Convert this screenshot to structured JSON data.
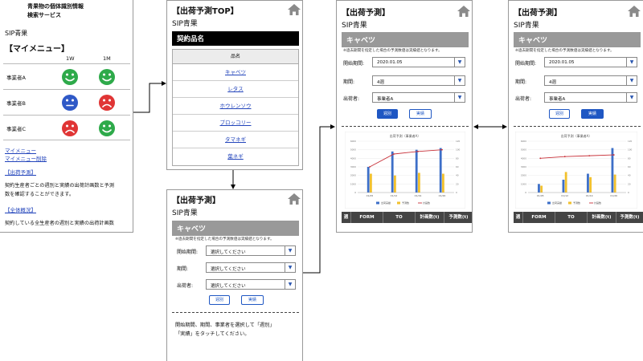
{
  "p1": {
    "service_line1": "青果物の個体識別情報",
    "service_line2": "検索サービス",
    "sip": "SIP青果",
    "menu_title": "【マイメニュー】",
    "col_1w": "1W",
    "col_1m": "1M",
    "rows": [
      {
        "label": "事業者A",
        "w": "happy",
        "m": "happy"
      },
      {
        "label": "事業者B",
        "w": "neutral",
        "m": "sad"
      },
      {
        "label": "事業者C",
        "w": "sad",
        "m": "happy"
      }
    ],
    "link_mymenu": "マイメニュー",
    "link_mymenu_delete": "マイメニュー削除",
    "sec1_title": "【出荷予測】",
    "sec1_text_1": "契約生産者ごとの週別と実績の出荷計画数と予測",
    "sec1_text_2": "数を確認することができます。",
    "sec2_title": "【全体概況】",
    "sec2_text": "契約している全生産者の週別と実績の出荷計画数"
  },
  "p2": {
    "title": "【出荷予測TOP】",
    "sip": "SIP青果",
    "bar": "契約品名",
    "table_header": "品名",
    "items": [
      "キャベツ",
      "レタス",
      "ホウレンソウ",
      "ブロッコリー",
      "タマネギ",
      "葉ネギ"
    ]
  },
  "p3": {
    "title": "【出荷予測】",
    "sip": "SIP青果",
    "bar": "キャベツ",
    "note": "※過去期間を指定した場合の予測数値は実績値となります。",
    "start_label": "開始期間:",
    "period_label": "期間:",
    "shipper_label": "出荷者:",
    "start_value": "選択してください",
    "period_value": "選択してください",
    "shipper_value": "選択してください",
    "btn_week": "週別",
    "btn_actual": "実績",
    "help_1": "開始期間、期間、事業者を選択して「週別」",
    "help_2": "「実績」をタッチしてください。"
  },
  "p4": {
    "title": "【出荷予測】",
    "sip": "SIP青果",
    "bar": "キャベツ",
    "note": "※過去期間を指定した場合の予測数値は実績値となります。",
    "start_label": "開始期間:",
    "period_label": "期間:",
    "shipper_label": "出荷者:",
    "start_value": "2020.01.05",
    "period_value": "4週",
    "shipper_value": "事業者A",
    "btn_week": "週別",
    "btn_actual": "実績",
    "table_cols": [
      "週",
      "FORM",
      "TO",
      "計画数(t)",
      "予測数(t)"
    ]
  },
  "p5": {
    "title": "【出荷予測】",
    "sip": "SIP青果",
    "bar": "キャベツ",
    "note": "※過去期間を指定した場合の予測数値は実績値となります。",
    "start_label": "開始期間:",
    "period_label": "期間:",
    "shipper_label": "出荷者:",
    "start_value": "2020.01.05",
    "period_value": "4週",
    "shipper_value": "事業者A",
    "btn_week": "週別",
    "btn_actual": "実績",
    "table_cols": [
      "週",
      "FORM",
      "TO",
      "計画数(t)",
      "予測数(t)"
    ]
  },
  "chart_data": [
    {
      "type": "bar",
      "title": "出荷予測（事業者A）",
      "categories": [
        "01/05",
        "01/12",
        "01/19",
        "01/26"
      ],
      "series": [
        {
          "name": "出荷実績",
          "values": [
            3000,
            4800,
            5000,
            5200
          ]
        },
        {
          "name": "予測数",
          "values": [
            2200,
            2000,
            2300,
            2200
          ]
        },
        {
          "name": "計画数",
          "values": [
            3000,
            4500,
            4800,
            5000
          ],
          "kind": "line"
        }
      ],
      "ylim": [
        0,
        6000
      ],
      "y2lim": [
        0,
        120
      ],
      "legend": "bottom",
      "colors": [
        "#3d6fc8",
        "#f2c12e",
        "#c8323a"
      ]
    },
    {
      "type": "bar",
      "title": "出荷予測（事業者A）",
      "categories": [
        "01/05",
        "01/12",
        "01/19",
        "01/26"
      ],
      "series": [
        {
          "name": "出荷実績",
          "values": [
            1000,
            1500,
            2200,
            5200
          ]
        },
        {
          "name": "予測数",
          "values": [
            800,
            2400,
            1800,
            2100
          ]
        },
        {
          "name": "計画数",
          "values": [
            4000,
            4200,
            4300,
            4400
          ],
          "kind": "line"
        }
      ],
      "ylim": [
        0,
        6000
      ],
      "y2lim": [
        0,
        120
      ],
      "legend": "bottom",
      "colors": [
        "#3d6fc8",
        "#f2c12e",
        "#c8323a"
      ]
    }
  ]
}
